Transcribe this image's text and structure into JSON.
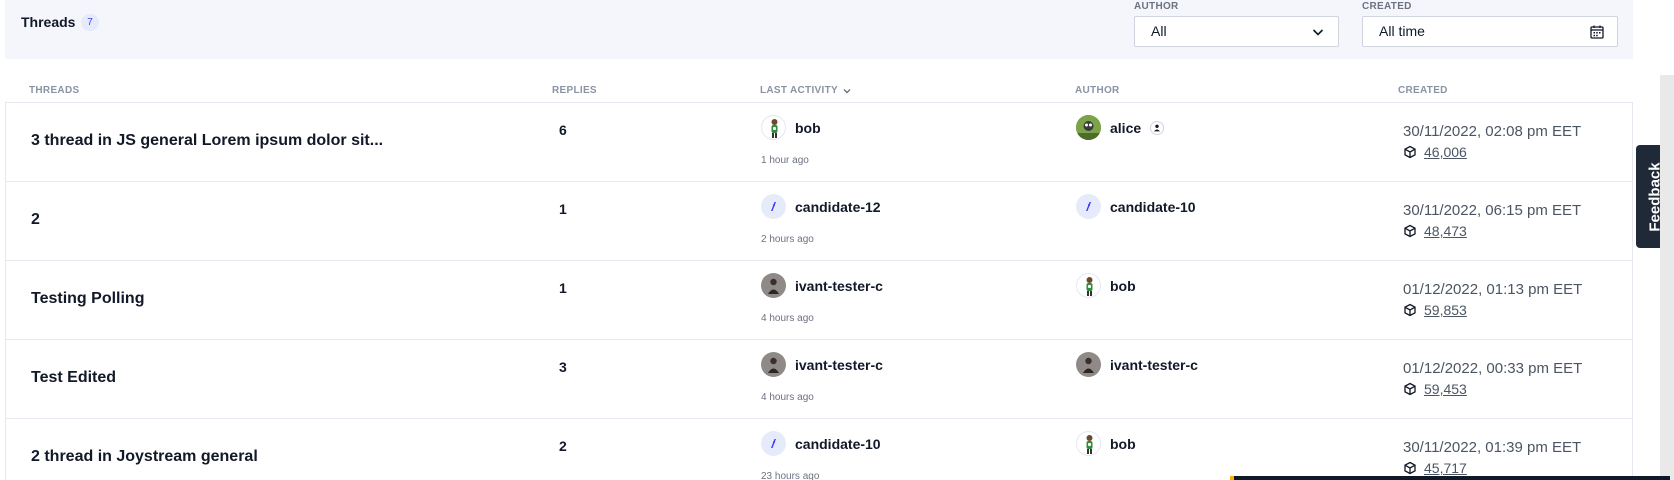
{
  "header": {
    "title": "Threads",
    "count": "7",
    "author_filter": {
      "label": "AUTHOR",
      "value": "All"
    },
    "created_filter": {
      "label": "CREATED",
      "value": "All time"
    }
  },
  "columns": {
    "threads": "THREADS",
    "replies": "REPLIES",
    "last_activity": "LAST ACTIVITY",
    "author": "AUTHOR",
    "created": "CREATED"
  },
  "rows": [
    {
      "title": "3 thread in JS general Lorem ipsum dolor sit...",
      "replies": "6",
      "last_activity": {
        "member": "bob",
        "avatar": "bob",
        "ago": "1 hour ago"
      },
      "author": {
        "member": "alice",
        "avatar": "alice",
        "role_icon": "person-icon"
      },
      "created": "30/11/2022, 02:08 pm EET",
      "block": "46,006"
    },
    {
      "title": "2",
      "replies": "1",
      "last_activity": {
        "member": "candidate-12",
        "avatar": "candidate",
        "ago": "2 hours ago"
      },
      "author": {
        "member": "candidate-10",
        "avatar": "candidate"
      },
      "created": "30/11/2022, 06:15 pm EET",
      "block": "48,473"
    },
    {
      "title": "Testing Polling",
      "replies": "1",
      "last_activity": {
        "member": "ivant-tester-c",
        "avatar": "ivant",
        "ago": "4 hours ago"
      },
      "author": {
        "member": "bob",
        "avatar": "bob"
      },
      "created": "01/12/2022, 01:13 pm EET",
      "block": "59,853"
    },
    {
      "title": "Test Edited",
      "replies": "3",
      "last_activity": {
        "member": "ivant-tester-c",
        "avatar": "ivant",
        "ago": "4 hours ago"
      },
      "author": {
        "member": "ivant-tester-c",
        "avatar": "ivant"
      },
      "created": "01/12/2022, 00:33 pm EET",
      "block": "59,453"
    },
    {
      "title": "2 thread in Joystream general",
      "replies": "2",
      "last_activity": {
        "member": "candidate-10",
        "avatar": "candidate",
        "ago": "23 hours ago"
      },
      "author": {
        "member": "bob",
        "avatar": "bob"
      },
      "created": "30/11/2022, 01:39 pm EET",
      "block": "45,717"
    }
  ],
  "feedback": {
    "label": "Feedback"
  },
  "colors": {
    "accent": "#4038ff",
    "header_bg": "#f4f6fb",
    "feedback_bg": "#1f2937"
  }
}
